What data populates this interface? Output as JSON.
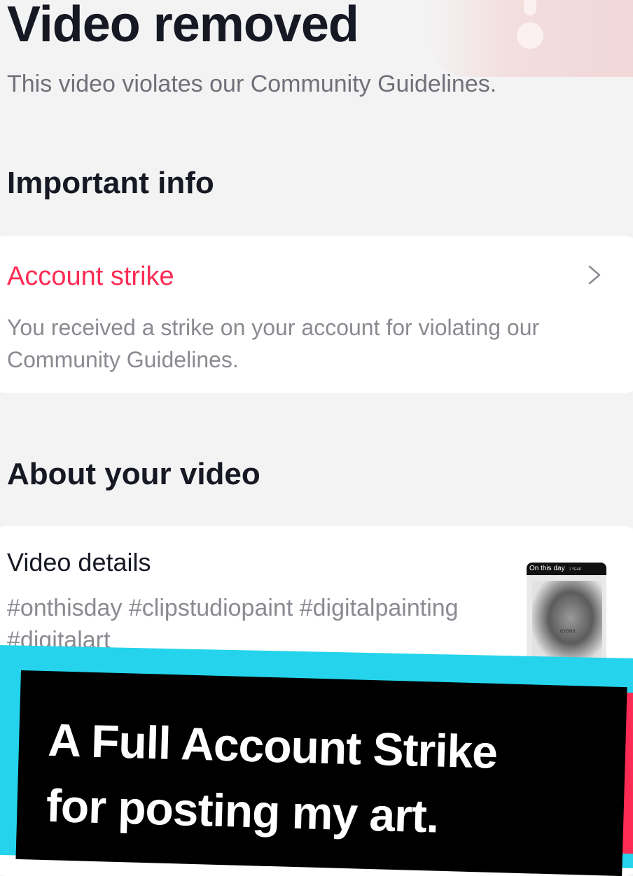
{
  "header": {
    "title": "Video removed",
    "subtitle": "This video violates our Community Guidelines."
  },
  "important_info": {
    "heading": "Important info",
    "strike_card": {
      "title": "Account strike",
      "description": "You received a strike on your account for violating our Community Guidelines."
    }
  },
  "about_video": {
    "heading": "About your video",
    "details_label": "Video details",
    "tags": "#onthisday #clipstudiopaint #digitalpainting #digitalart",
    "thumbnail": {
      "header_text": "On this day",
      "header_subtext": "1 YEAR",
      "art_label": "CYGNS"
    }
  },
  "overlay_caption": {
    "line1": "A Full Account Strike",
    "line2": "for posting my art."
  },
  "colors": {
    "accent_red": "#fe2c55",
    "overlay_cyan": "#25d4ec",
    "text_primary": "#161823",
    "text_secondary": "#8a8b91",
    "background": "#f3f3f4"
  },
  "icons": {
    "chevron": "chevron-right-icon",
    "warning": "warning-icon"
  }
}
